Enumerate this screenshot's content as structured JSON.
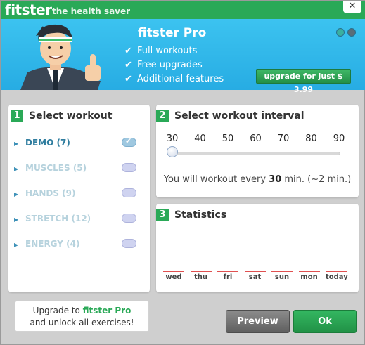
{
  "titlebar": {
    "logo": "fitster",
    "tagline": "the health saver",
    "close": "✕"
  },
  "banner": {
    "title": "fitster Pro",
    "features": [
      "Full workouts",
      "Free upgrades",
      "Additional features"
    ],
    "check_glyph": "✔",
    "upgrade_label": "upgrade for just $ 3.99"
  },
  "workout": {
    "number": "1",
    "title": "Select workout",
    "items": [
      {
        "label": "DEMO",
        "count": "(7)",
        "checked": true
      },
      {
        "label": "MUSCLES",
        "count": "(5)",
        "checked": false
      },
      {
        "label": "HANDS",
        "count": "(9)",
        "checked": false
      },
      {
        "label": "STRETCH",
        "count": "(12)",
        "checked": false
      },
      {
        "label": "ENERGY",
        "count": "(4)",
        "checked": false
      }
    ]
  },
  "interval": {
    "number": "2",
    "title": "Select workout interval",
    "ticks": [
      "30",
      "40",
      "50",
      "60",
      "70",
      "80",
      "90"
    ],
    "selected_minutes": 30,
    "text_before": "You will workout every ",
    "value_text": "30",
    "text_after": " min. (~2 min.)"
  },
  "stats": {
    "number": "3",
    "title": "Statistics",
    "days": [
      "wed",
      "thu",
      "fri",
      "sat",
      "sun",
      "mon",
      "today"
    ]
  },
  "footer": {
    "note_line1_prefix": "Upgrade to ",
    "note_brand": "fitster Pro",
    "note_line2": "and unlock all exercises!",
    "preview_label": "Preview",
    "ok_label": "Ok"
  },
  "colors": {
    "brand_green": "#2aa957",
    "banner_blue": "#2eb3e8",
    "stat_bar": "#e05050"
  }
}
